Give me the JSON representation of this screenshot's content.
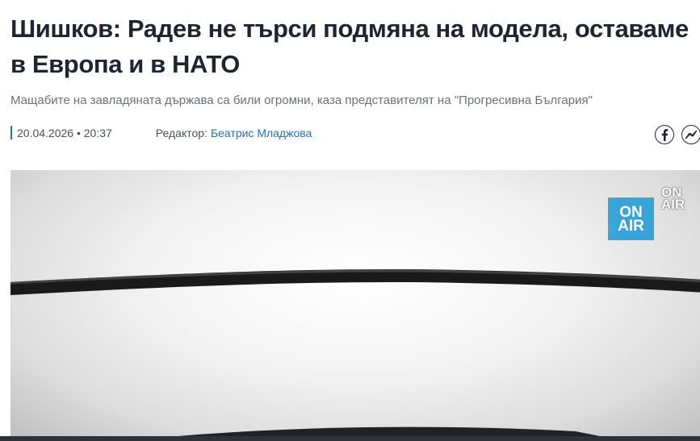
{
  "article": {
    "headline": "Шишков: Радев не търси подмяна на модела, оставаме в Европа и в НАТО",
    "subtitle": "Мащабите на завладяната държава са били огромни, каза представителят на \"Прогресивна България\"",
    "date": "20.04.2026 • 20:37",
    "editor_label": "Редактор:",
    "editor_name": "Беатрис Младжова"
  },
  "share": {
    "icons": [
      "facebook-icon",
      "messenger-icon"
    ]
  },
  "video": {
    "logo_line1": "ON",
    "logo_line2": "AIR",
    "ghost_line1": "ON",
    "ghost_line2": "AIR"
  },
  "colors": {
    "headline": "#1d2533",
    "accent": "#2a6fb5",
    "logo": "#2b9fd8"
  }
}
